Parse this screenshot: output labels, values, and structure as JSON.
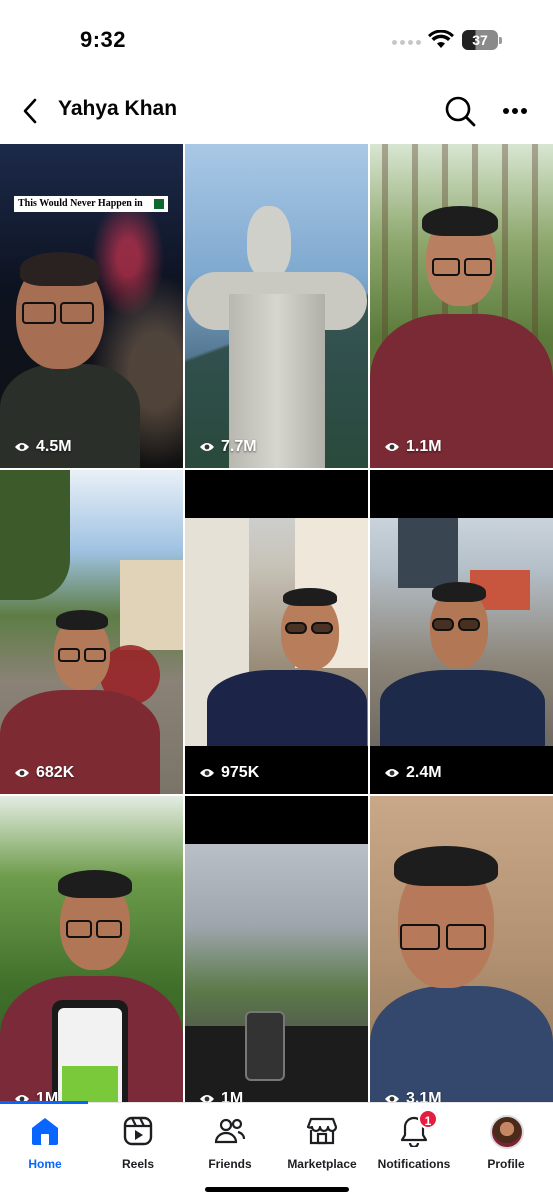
{
  "status_bar": {
    "time": "9:32",
    "battery": "37"
  },
  "header": {
    "title": "Yahya Khan",
    "back_icon": "chevron-left-icon",
    "search_icon": "search-icon",
    "more_icon": "ellipsis-icon"
  },
  "videos": [
    {
      "views": "4.5M",
      "caption": "This Would Never Happen in"
    },
    {
      "views": "7.7M"
    },
    {
      "views": "1.1M"
    },
    {
      "views": "682K"
    },
    {
      "views": "975K"
    },
    {
      "views": "2.4M"
    },
    {
      "views": "1M"
    },
    {
      "views": "1M"
    },
    {
      "views": "3.1M"
    }
  ],
  "tabbar": {
    "items": [
      {
        "label": "Home",
        "icon": "home-icon",
        "active": true
      },
      {
        "label": "Reels",
        "icon": "reels-icon"
      },
      {
        "label": "Friends",
        "icon": "friends-icon"
      },
      {
        "label": "Marketplace",
        "icon": "marketplace-icon"
      },
      {
        "label": "Notifications",
        "icon": "bell-icon",
        "badge": "1"
      },
      {
        "label": "Profile",
        "icon": "avatar"
      }
    ]
  },
  "colors": {
    "accent": "#0866ff",
    "badge": "#e41e3f"
  }
}
